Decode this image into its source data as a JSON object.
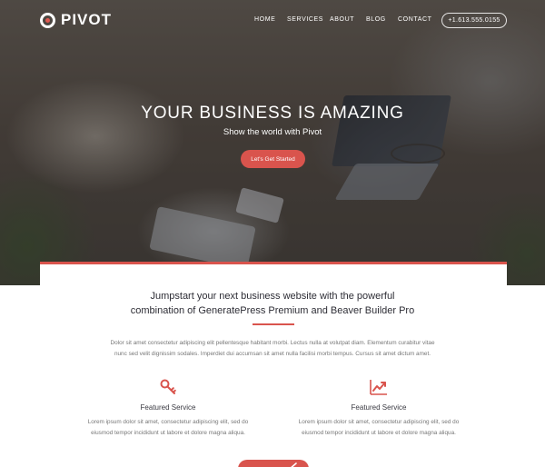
{
  "brand": {
    "name": "PIVOT",
    "accent": "#d9544d"
  },
  "nav": {
    "items": [
      "HOME",
      "SERVICES",
      "ABOUT",
      "BLOG",
      "CONTACT"
    ],
    "phone": "+1.613.555.0155"
  },
  "hero": {
    "title": "YOUR BUSINESS IS AMAZING",
    "subtitle": "Show the world with Pivot",
    "cta_label": "Let's Get Started"
  },
  "main": {
    "headline_line1": "Jumpstart your next business website with the powerful",
    "headline_line2": "combination of GeneratePress Premium and Beaver Builder Pro",
    "intro_line1": "Dolor sit amet consectetur adipiscing elit pellentesque habitant morbi. Lectus nulla at volutpat diam. Elementum curabitur vitae",
    "intro_line2": "nunc sed velit dignissim sodales. Imperdiet dui accumsan sit amet nulla facilisi morbi tempus. Cursus sit amet dictum amet."
  },
  "services": [
    {
      "icon": "key-icon",
      "title": "Featured Service",
      "text_line1": "Lorem ipsum dolor sit amet, consectetur adipiscing elit, sed do",
      "text_line2": "eiusmod tempor incididunt ut labore et dolore magna aliqua."
    },
    {
      "icon": "trending-up-icon",
      "title": "Featured Service",
      "text_line1": "Lorem ipsum dolor sit amet, consectetur adipiscing elit, sed do",
      "text_line2": "eiusmod tempor incididunt ut labore et dolore magna aliqua."
    }
  ]
}
